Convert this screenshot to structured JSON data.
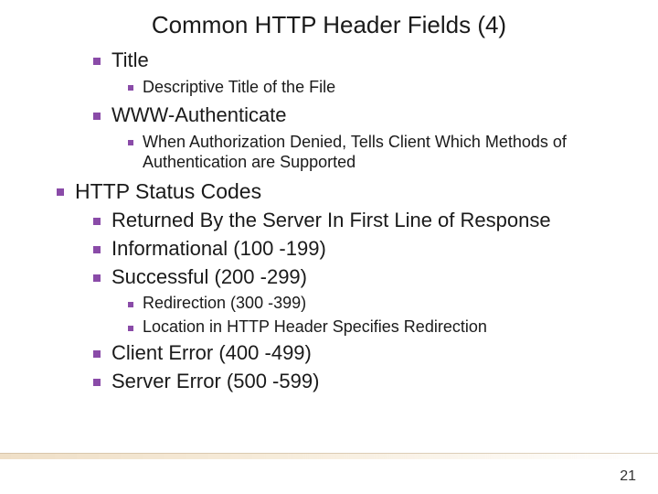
{
  "title": "Common HTTP Header Fields (4)",
  "items": {
    "a1": "Title",
    "a1_1": "Descriptive Title of the File",
    "a2": "WWW-Authenticate",
    "a2_1": "When Authorization Denied, Tells Client Which Methods of Authentication are Supported",
    "b1": "HTTP Status Codes",
    "b1_1": "Returned By the Server In First Line of Response",
    "b1_2": "Informational (100 -199)",
    "b1_3": "Successful (200 -299)",
    "b1_3_1": "Redirection (300 -399)",
    "b1_3_2": "Location in HTTP Header Specifies Redirection",
    "b1_4": "Client Error (400 -499)",
    "b1_5": "Server Error (500 -599)"
  },
  "page_number": "21"
}
